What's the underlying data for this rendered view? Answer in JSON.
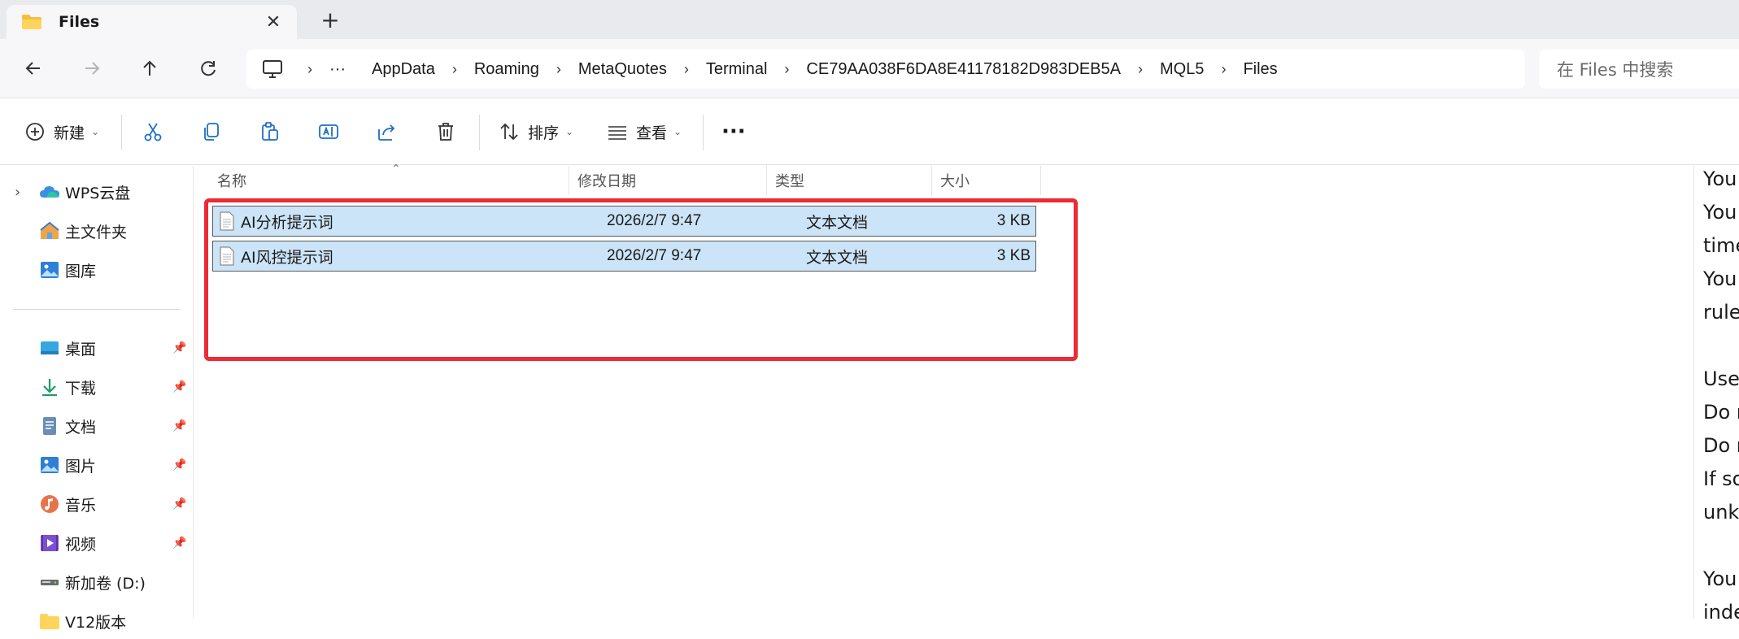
{
  "tab": {
    "title": "Files",
    "close_glyph": "✕",
    "new_tab_glyph": "+"
  },
  "nav": {
    "breadcrumbs": [
      "AppData",
      "Roaming",
      "MetaQuotes",
      "Terminal",
      "CE79AA038F6DA8E41178182D983DEB5A",
      "MQL5",
      "Files"
    ],
    "overflow": "···",
    "separator": "›",
    "search_placeholder": "在 Files 中搜索"
  },
  "toolbar": {
    "new_label": "新建",
    "sort_label": "排序",
    "view_label": "查看",
    "more_label": "···"
  },
  "sidebar": {
    "top_items": [
      {
        "label": "WPS云盘",
        "icon": "cloud-icon"
      },
      {
        "label": "主文件夹",
        "icon": "home-icon"
      },
      {
        "label": "图库",
        "icon": "gallery-icon"
      }
    ],
    "quick_items": [
      {
        "label": "桌面",
        "icon": "desktop-icon"
      },
      {
        "label": "下载",
        "icon": "download-icon"
      },
      {
        "label": "文档",
        "icon": "documents-icon"
      },
      {
        "label": "图片",
        "icon": "pictures-icon"
      },
      {
        "label": "音乐",
        "icon": "music-icon"
      },
      {
        "label": "视频",
        "icon": "videos-icon"
      },
      {
        "label": "新加卷 (D:)",
        "icon": "drive-icon"
      },
      {
        "label": "V12版本",
        "icon": "folder-icon"
      }
    ]
  },
  "file_list": {
    "columns": {
      "name": "名称",
      "date": "修改日期",
      "type": "类型",
      "size": "大小"
    },
    "rows": [
      {
        "name": "AI分析提示词",
        "date": "2026/2/7 9:47",
        "type": "文本文档",
        "size": "3 KB"
      },
      {
        "name": "AI风控提示词",
        "date": "2026/2/7 9:47",
        "type": "文本文档",
        "size": "3 KB"
      }
    ]
  },
  "preview": {
    "lines": [
      "You",
      "You",
      "time",
      "You",
      "rule",
      "",
      "Use",
      "Do n",
      "Do n",
      "If so",
      "unkn",
      "",
      "You",
      "inde"
    ]
  },
  "colors": {
    "selection": "#cce4f7",
    "highlight_box": "#ec2b35",
    "accent": "#0f6cbd"
  }
}
